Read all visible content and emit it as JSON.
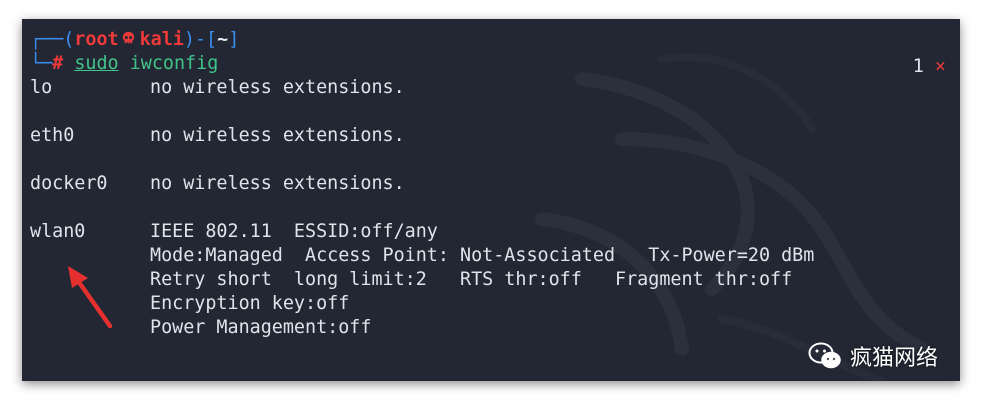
{
  "prompt": {
    "user": "root",
    "host": "kali",
    "dir": "~",
    "symbol": "#"
  },
  "command": {
    "sudo": "sudo",
    "rest": "iwconfig"
  },
  "exit_status": {
    "code": "1",
    "mark": "×"
  },
  "output": [
    {
      "iface": "lo",
      "info": "no wireless extensions."
    },
    {
      "iface": "eth0",
      "info": "no wireless extensions."
    },
    {
      "iface": "docker0",
      "info": "no wireless extensions."
    },
    {
      "iface": "wlan0",
      "info": "IEEE 802.11  ESSID:off/any"
    }
  ],
  "wlan0_details": [
    "Mode:Managed  Access Point: Not-Associated   Tx-Power=20 dBm",
    "Retry short  long limit:2   RTS thr:off   Fragment thr:off",
    "Encryption key:off",
    "Power Management:off"
  ],
  "watermark": {
    "text": "疯猫网络",
    "icon": "wechat-icon"
  },
  "colors": {
    "terminal_bg": "#222733",
    "prompt_blue": "#3b8ef0",
    "prompt_red": "#ee3a3a",
    "command_green": "#41c38a",
    "arrow_red": "#e53030"
  }
}
